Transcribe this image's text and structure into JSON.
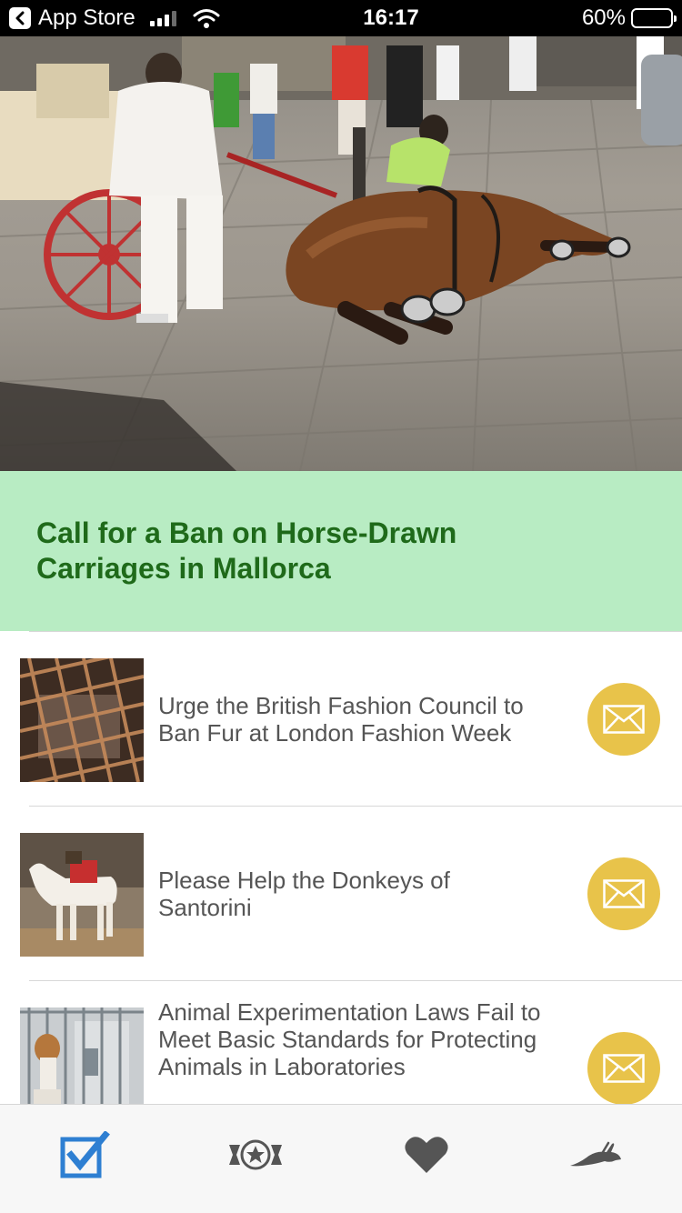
{
  "status_bar": {
    "back_label": "App Store",
    "time": "16:17",
    "battery_text": "60%",
    "battery_level": 0.6
  },
  "hero": {
    "image_icon": "horse-photo"
  },
  "featured": {
    "title": "Call for a Ban on Horse-Drawn Carriages in Mallorca"
  },
  "list": {
    "items": [
      {
        "title": "Urge the British Fashion Council to Ban Fur at London Fashion Week",
        "thumb_icon": "caged-animal-photo",
        "action_icon": "envelope-icon"
      },
      {
        "title": "Please Help the Donkeys of Santorini",
        "thumb_icon": "donkey-photo",
        "action_icon": "envelope-icon"
      },
      {
        "title": "Animal Experimentation Laws Fail to Meet Basic Standards for Protecting Animals in Laboratories",
        "thumb_icon": "beagle-photo",
        "action_icon": "envelope-icon"
      }
    ]
  },
  "tab_bar": {
    "tabs": [
      {
        "icon": "checkbox-icon",
        "active": true
      },
      {
        "icon": "badge-star-icon",
        "active": false
      },
      {
        "icon": "heart-icon",
        "active": false
      },
      {
        "icon": "rabbit-icon",
        "active": false
      }
    ]
  },
  "colors": {
    "featured_bg": "#b8ecc3",
    "featured_text": "#1f6a1a",
    "mail_button": "#e8c34a",
    "tab_active": "#2e7fd2",
    "tab_inactive": "#555555"
  }
}
